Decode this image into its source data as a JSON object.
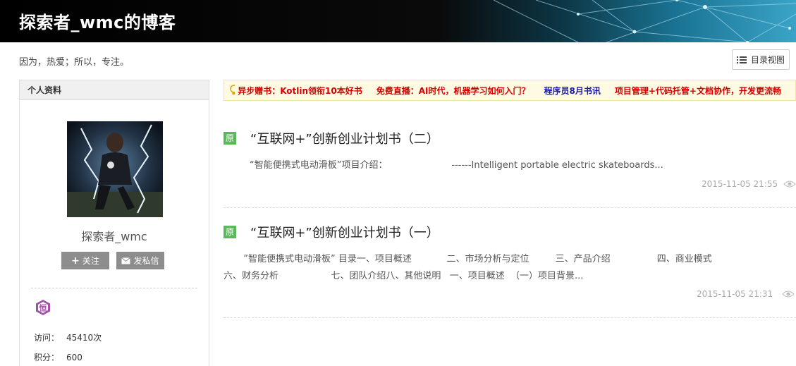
{
  "header": {
    "blog_title": "探索者_wmc的博客",
    "tagline": "因为，热爱；所以，专注。"
  },
  "toolbar": {
    "catalog_view_label": "目录视图"
  },
  "sidebar": {
    "panel_title": "个人资料",
    "username": "探索者_wmc",
    "follow_label": "关注",
    "message_label": "发私信",
    "badge_char": "恒",
    "stats": [
      {
        "label": "访问：",
        "value": "45410次"
      },
      {
        "label": "积分：",
        "value": "600"
      }
    ]
  },
  "notices": [
    {
      "text": "异步赠书：Kotlin领衔10本好书",
      "color": "#d40000"
    },
    {
      "text": "免费直播：AI时代，机器学习如何入门？",
      "color": "#d40000"
    },
    {
      "text": "程序员8月书讯",
      "color": "#1a1aa8"
    },
    {
      "text": "项目管理+代码托管+文档协作，开发更流畅",
      "color": "#d40000"
    }
  ],
  "articles": [
    {
      "tag": "原",
      "title": "“互联网+”创新创业计划书（二）",
      "summary_lines": [
        "“智能便携式电动滑板”项目介绍：                      ------Intelligent portable electric skateboards..."
      ],
      "date": "2015-11-05 21:55"
    },
    {
      "tag": "原",
      "title": "“互联网+”创新创业计划书（一）",
      "summary_lines": [
        "  ”智能便携式电动滑板” 目录一、项目概述            二、市场分析与定位         三、产品介绍                四、商业模式",
        "六、财务分析                  七、团队介绍八、其他说明   一、项目概述  （一）项目背景..."
      ],
      "date": "2015-11-05 21:31"
    }
  ],
  "colors": {
    "notice_bg": "#fffbe3",
    "tag_green": "#5cb85c",
    "button_gray": "#8d8d8d"
  }
}
